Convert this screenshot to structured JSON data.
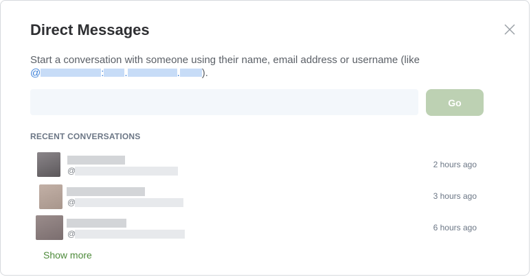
{
  "dialog": {
    "title": "Direct Messages",
    "subtitle_prefix": "Start a conversation with someone using their name, email address or username (like",
    "subtitle_example_at": "@",
    "subtitle_example_colon": ":",
    "subtitle_example_dot1": ".",
    "subtitle_example_dot2": ".",
    "subtitle_suffix": ").",
    "close_icon": "close-icon"
  },
  "search": {
    "value": "",
    "placeholder": ""
  },
  "go_button": {
    "label": "Go",
    "color": "#bdd1b3"
  },
  "recent": {
    "heading": "RECENT CONVERSATIONS",
    "items": [
      {
        "at": "@",
        "time": "2 hours ago",
        "avatar_color": "#6f6a6d"
      },
      {
        "at": "@",
        "time": "3 hours ago",
        "avatar_color": "#b8a69b"
      },
      {
        "at": "@",
        "time": "6 hours ago",
        "avatar_color": "#8c7e7e"
      }
    ],
    "show_more": "Show more"
  },
  "colors": {
    "accent_link": "#4d8a3a",
    "redaction_blue": "#c7dcf7",
    "input_bg": "#f3f7fb"
  }
}
